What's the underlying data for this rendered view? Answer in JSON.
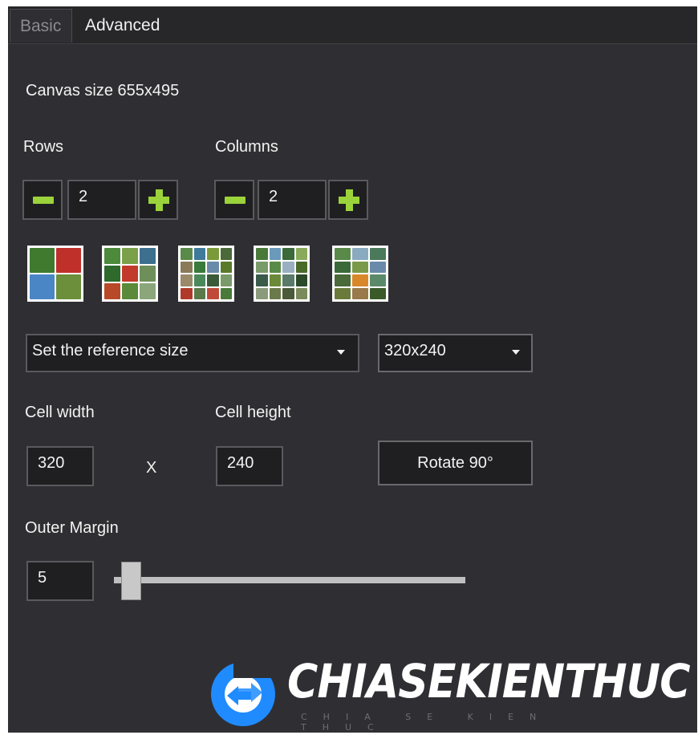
{
  "tabs": {
    "basic": "Basic",
    "advanced": "Advanced"
  },
  "canvas_size": "Canvas size 655x495",
  "rows": {
    "label": "Rows",
    "value": "2"
  },
  "columns": {
    "label": "Columns",
    "value": "2"
  },
  "layout_presets": [
    "2x2",
    "3x3",
    "4x4",
    "4x4b",
    "4x4c"
  ],
  "reference": {
    "selected": "Set the reference size",
    "size": "320x240"
  },
  "cell": {
    "width_label": "Cell width",
    "height_label": "Cell height",
    "width": "320",
    "height": "240",
    "times": "X"
  },
  "rotate_label": "Rotate 90°",
  "outer_margin": {
    "label": "Outer Margin",
    "value": "5",
    "slider_fraction": 0.05
  },
  "watermark": {
    "text": "CHIASEKIENTHUC",
    "subtext": "CHIA SE KIEN THUC"
  },
  "colors": {
    "accent": "#9bd33b",
    "panel": "#2f2f33",
    "logo_blue": "#1f8bff"
  }
}
